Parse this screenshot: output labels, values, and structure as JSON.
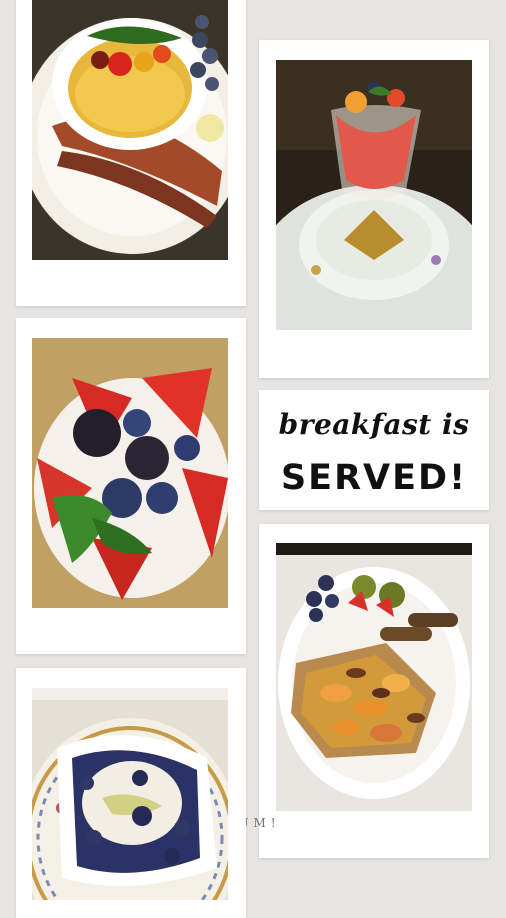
{
  "heading": {
    "script_text": "breakfast is",
    "bold_text": "SERVED!"
  },
  "caption": "YUM!",
  "photos": [
    "egg-souffle-with-tomatoes-and-bacon",
    "fruit-cup-in-glass",
    "strawberries-blackberries-blueberries",
    "french-toast-with-peaches",
    "blueberry-cream-ramekin"
  ],
  "colors": {
    "background": "#e7e5e3",
    "card": "#ffffff",
    "text": "#111111",
    "caption": "#7a6f66"
  }
}
